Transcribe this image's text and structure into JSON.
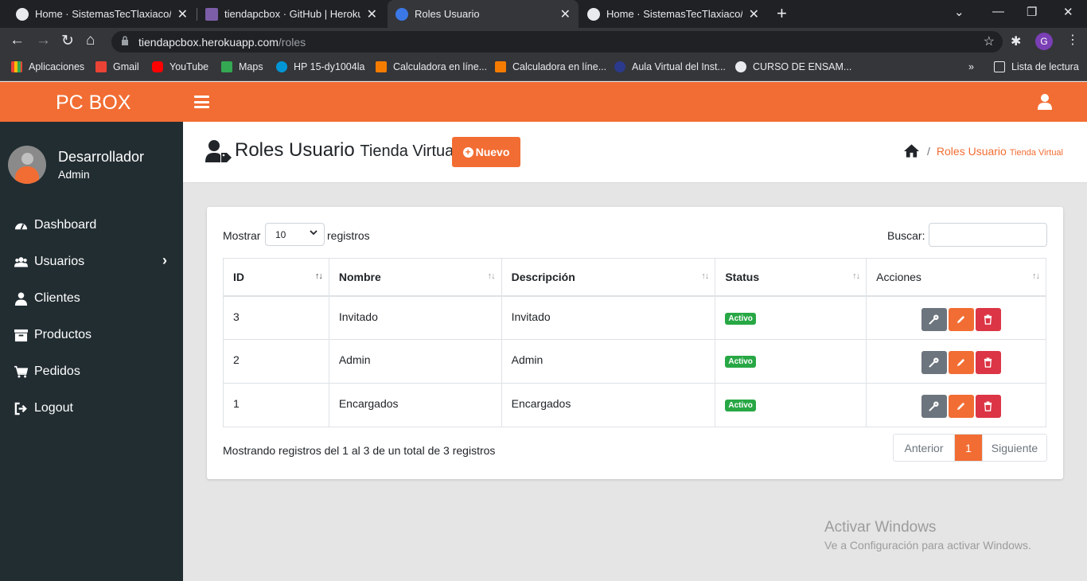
{
  "browser": {
    "tabs": [
      {
        "title": "Home · SistemasTecTlaxiaco/tienda"
      },
      {
        "title": "tiendapcbox · GitHub | Heroku"
      },
      {
        "title": "Roles Usuario"
      },
      {
        "title": "Home · SistemasTecTlaxiaco/Oaxa"
      }
    ],
    "url_host": "tiendapcbox.herokuapp.com",
    "url_path": "/roles",
    "profile_initial": "G",
    "bookmarks": [
      "Aplicaciones",
      "Gmail",
      "YouTube",
      "Maps",
      "HP 15-dy1004la",
      "Calculadora en líne...",
      "Calculadora en líne...",
      "Aula Virtual del Inst...",
      "CURSO DE ENSAM..."
    ],
    "reading_list": "Lista de lectura"
  },
  "app": {
    "brand": "PC BOX",
    "accent": "#f26d33"
  },
  "sidebar": {
    "user_name": "Desarrollador",
    "user_role": "Admin",
    "items": [
      {
        "label": "Dashboard"
      },
      {
        "label": "Usuarios"
      },
      {
        "label": "Clientes"
      },
      {
        "label": "Productos"
      },
      {
        "label": "Pedidos"
      },
      {
        "label": "Logout"
      }
    ]
  },
  "page": {
    "title": "Roles Usuario",
    "subtitle": "Tienda Virtual",
    "new_button": "Nuevo",
    "breadcrumb_current": "Roles Usuario",
    "breadcrumb_small": "Tienda Virtual"
  },
  "table_controls": {
    "show_label": "Mostrar",
    "page_length": "10",
    "records_label": "registros",
    "search_label": "Buscar:"
  },
  "table": {
    "headers": [
      "ID",
      "Nombre",
      "Descripción",
      "Status",
      "Acciones"
    ],
    "rows": [
      {
        "id": "3",
        "nombre": "Invitado",
        "descripcion": "Invitado",
        "status": "Activo"
      },
      {
        "id": "2",
        "nombre": "Admin",
        "descripcion": "Admin",
        "status": "Activo"
      },
      {
        "id": "1",
        "nombre": "Encargados",
        "descripcion": "Encargados",
        "status": "Activo"
      }
    ]
  },
  "footer": {
    "info": "Mostrando registros del 1 al 3 de un total de 3 registros",
    "prev": "Anterior",
    "page": "1",
    "next": "Siguiente"
  },
  "watermark": {
    "line1": "Activar Windows",
    "line2": "Ve a Configuración para activar Windows."
  }
}
